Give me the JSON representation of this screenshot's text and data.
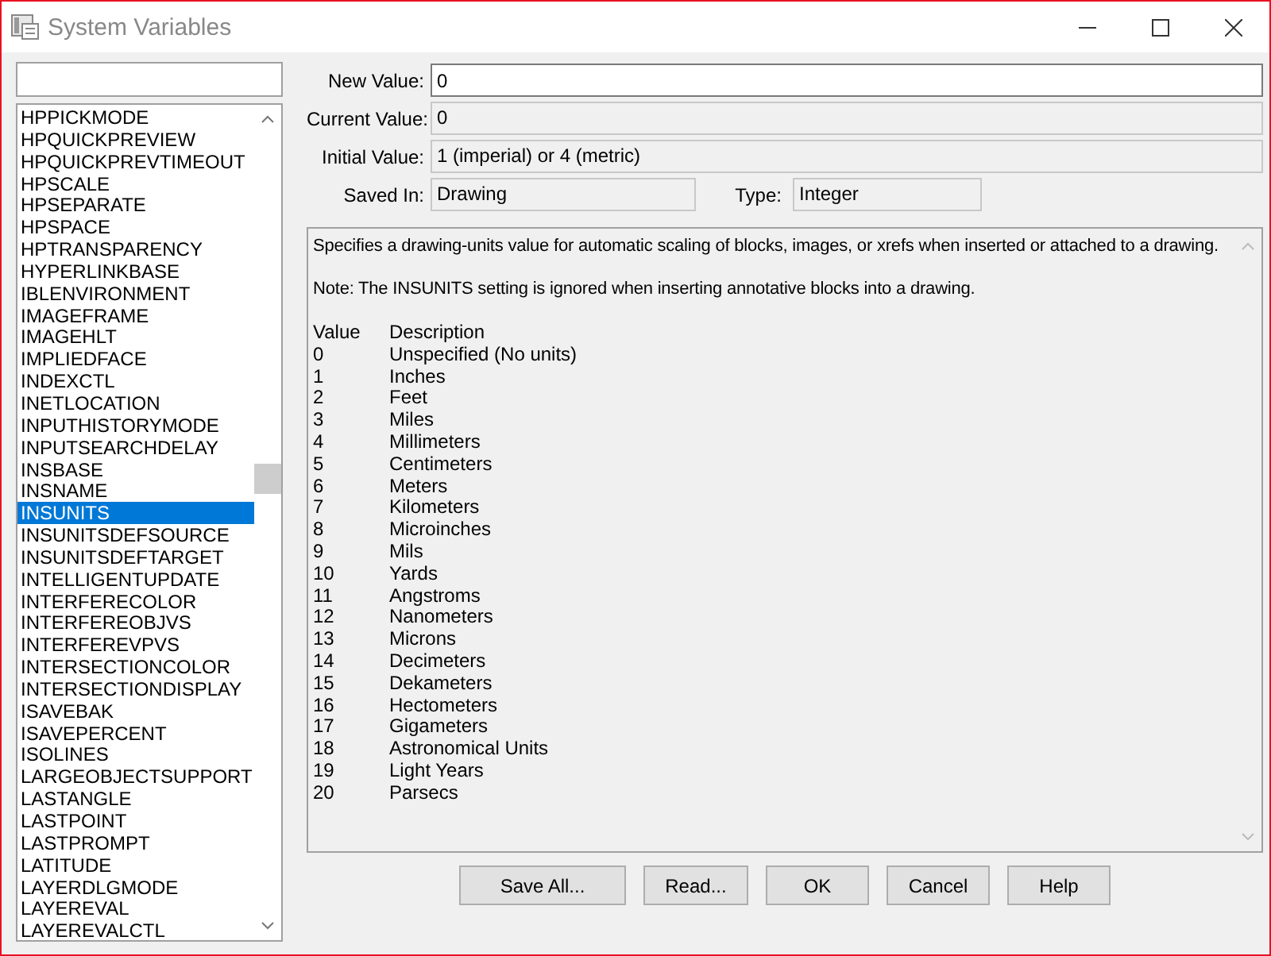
{
  "window": {
    "title": "System Variables"
  },
  "variables": [
    {
      "name": "HPPICKMODE",
      "selected": false
    },
    {
      "name": "HPQUICKPREVIEW",
      "selected": false
    },
    {
      "name": "HPQUICKPREVTIMEOUT",
      "selected": false
    },
    {
      "name": "HPSCALE",
      "selected": false
    },
    {
      "name": "HPSEPARATE",
      "selected": false
    },
    {
      "name": "HPSPACE",
      "selected": false
    },
    {
      "name": "HPTRANSPARENCY",
      "selected": false
    },
    {
      "name": "HYPERLINKBASE",
      "selected": false
    },
    {
      "name": "IBLENVIRONMENT",
      "selected": false
    },
    {
      "name": "IMAGEFRAME",
      "selected": false
    },
    {
      "name": "IMAGEHLT",
      "selected": false
    },
    {
      "name": "IMPLIEDFACE",
      "selected": false
    },
    {
      "name": "INDEXCTL",
      "selected": false
    },
    {
      "name": "INETLOCATION",
      "selected": false
    },
    {
      "name": "INPUTHISTORYMODE",
      "selected": false
    },
    {
      "name": "INPUTSEARCHDELAY",
      "selected": false
    },
    {
      "name": "INSBASE",
      "selected": false
    },
    {
      "name": "INSNAME",
      "selected": false
    },
    {
      "name": "INSUNITS",
      "selected": true
    },
    {
      "name": "INSUNITSDEFSOURCE",
      "selected": false
    },
    {
      "name": "INSUNITSDEFTARGET",
      "selected": false
    },
    {
      "name": "INTELLIGENTUPDATE",
      "selected": false
    },
    {
      "name": "INTERFERECOLOR",
      "selected": false
    },
    {
      "name": "INTERFEREOBJVS",
      "selected": false
    },
    {
      "name": "INTERFEREVPVS",
      "selected": false
    },
    {
      "name": "INTERSECTIONCOLOR",
      "selected": false
    },
    {
      "name": "INTERSECTIONDISPLAY",
      "selected": false
    },
    {
      "name": "ISAVEBAK",
      "selected": false
    },
    {
      "name": "ISAVEPERCENT",
      "selected": false
    },
    {
      "name": "ISOLINES",
      "selected": false
    },
    {
      "name": "LARGEOBJECTSUPPORT",
      "selected": false
    },
    {
      "name": "LASTANGLE",
      "selected": false
    },
    {
      "name": "LASTPOINT",
      "selected": false
    },
    {
      "name": "LASTPROMPT",
      "selected": false
    },
    {
      "name": "LATITUDE",
      "selected": false
    },
    {
      "name": "LAYERDLGMODE",
      "selected": false
    },
    {
      "name": "LAYEREVAL",
      "selected": false
    },
    {
      "name": "LAYEREVALCTL",
      "selected": false
    }
  ],
  "new_value": {
    "label": "New Value:",
    "value": "0"
  },
  "current_value": {
    "label": "Current Value:",
    "value": "0"
  },
  "initial_value": {
    "label": "Initial Value:",
    "value": "1 (imperial) or 4 (metric)"
  },
  "saved_in": {
    "label": "Saved In:",
    "value": "Drawing"
  },
  "type": {
    "label": "Type:",
    "value": "Integer"
  },
  "description": {
    "paragraphs": [
      "Specifies a drawing-units value for automatic scaling of blocks, images, or xrefs when inserted or attached to a drawing.",
      "Note: The INSUNITS setting is ignored when inserting annotative blocks into a drawing."
    ],
    "columns": [
      "Value",
      "Description"
    ],
    "rows": [
      [
        "0",
        "Unspecified (No units)"
      ],
      [
        "1",
        "Inches"
      ],
      [
        "2",
        "Feet"
      ],
      [
        "3",
        "Miles"
      ],
      [
        "4",
        "Millimeters"
      ],
      [
        "5",
        "Centimeters"
      ],
      [
        "6",
        "Meters"
      ],
      [
        "7",
        "Kilometers"
      ],
      [
        "8",
        "Microinches"
      ],
      [
        "9",
        "Mils"
      ],
      [
        "10",
        "Yards"
      ],
      [
        "11",
        "Angstroms"
      ],
      [
        "12",
        "Nanometers"
      ],
      [
        "13",
        "Microns"
      ],
      [
        "14",
        "Decimeters"
      ],
      [
        "15",
        "Dekameters"
      ],
      [
        "16",
        "Hectometers"
      ],
      [
        "17",
        "Gigameters"
      ],
      [
        "18",
        "Astronomical Units"
      ],
      [
        "19",
        "Light Years"
      ],
      [
        "20",
        "Parsecs"
      ]
    ]
  },
  "buttons": [
    {
      "label": "Save All..."
    },
    {
      "label": "Read..."
    },
    {
      "label": "OK"
    },
    {
      "label": "Cancel"
    },
    {
      "label": "Help"
    }
  ]
}
